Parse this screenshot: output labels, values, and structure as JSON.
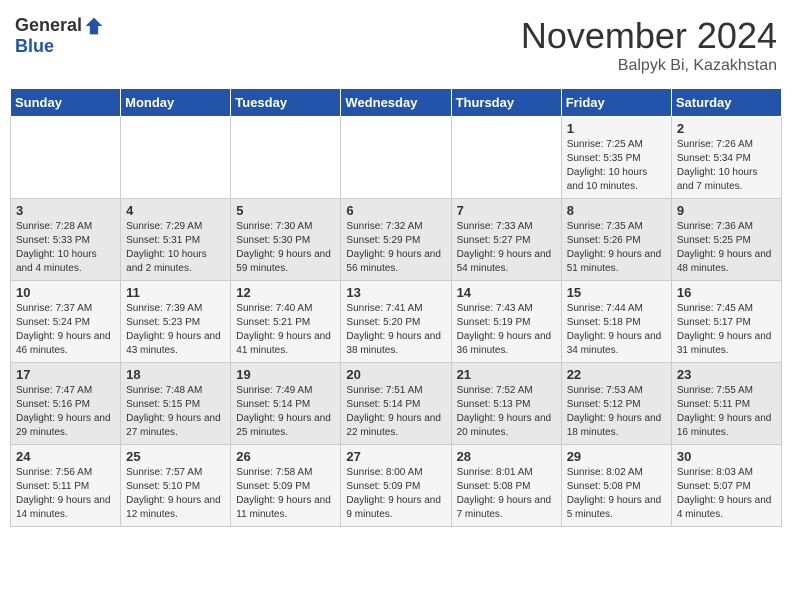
{
  "logo": {
    "general": "General",
    "blue": "Blue"
  },
  "title": {
    "month": "November 2024",
    "location": "Balpyk Bi, Kazakhstan"
  },
  "weekdays": [
    "Sunday",
    "Monday",
    "Tuesday",
    "Wednesday",
    "Thursday",
    "Friday",
    "Saturday"
  ],
  "weeks": [
    [
      {
        "day": "",
        "sunrise": "",
        "sunset": "",
        "daylight": ""
      },
      {
        "day": "",
        "sunrise": "",
        "sunset": "",
        "daylight": ""
      },
      {
        "day": "",
        "sunrise": "",
        "sunset": "",
        "daylight": ""
      },
      {
        "day": "",
        "sunrise": "",
        "sunset": "",
        "daylight": ""
      },
      {
        "day": "",
        "sunrise": "",
        "sunset": "",
        "daylight": ""
      },
      {
        "day": "1",
        "sunrise": "Sunrise: 7:25 AM",
        "sunset": "Sunset: 5:35 PM",
        "daylight": "Daylight: 10 hours and 10 minutes."
      },
      {
        "day": "2",
        "sunrise": "Sunrise: 7:26 AM",
        "sunset": "Sunset: 5:34 PM",
        "daylight": "Daylight: 10 hours and 7 minutes."
      }
    ],
    [
      {
        "day": "3",
        "sunrise": "Sunrise: 7:28 AM",
        "sunset": "Sunset: 5:33 PM",
        "daylight": "Daylight: 10 hours and 4 minutes."
      },
      {
        "day": "4",
        "sunrise": "Sunrise: 7:29 AM",
        "sunset": "Sunset: 5:31 PM",
        "daylight": "Daylight: 10 hours and 2 minutes."
      },
      {
        "day": "5",
        "sunrise": "Sunrise: 7:30 AM",
        "sunset": "Sunset: 5:30 PM",
        "daylight": "Daylight: 9 hours and 59 minutes."
      },
      {
        "day": "6",
        "sunrise": "Sunrise: 7:32 AM",
        "sunset": "Sunset: 5:29 PM",
        "daylight": "Daylight: 9 hours and 56 minutes."
      },
      {
        "day": "7",
        "sunrise": "Sunrise: 7:33 AM",
        "sunset": "Sunset: 5:27 PM",
        "daylight": "Daylight: 9 hours and 54 minutes."
      },
      {
        "day": "8",
        "sunrise": "Sunrise: 7:35 AM",
        "sunset": "Sunset: 5:26 PM",
        "daylight": "Daylight: 9 hours and 51 minutes."
      },
      {
        "day": "9",
        "sunrise": "Sunrise: 7:36 AM",
        "sunset": "Sunset: 5:25 PM",
        "daylight": "Daylight: 9 hours and 48 minutes."
      }
    ],
    [
      {
        "day": "10",
        "sunrise": "Sunrise: 7:37 AM",
        "sunset": "Sunset: 5:24 PM",
        "daylight": "Daylight: 9 hours and 46 minutes."
      },
      {
        "day": "11",
        "sunrise": "Sunrise: 7:39 AM",
        "sunset": "Sunset: 5:23 PM",
        "daylight": "Daylight: 9 hours and 43 minutes."
      },
      {
        "day": "12",
        "sunrise": "Sunrise: 7:40 AM",
        "sunset": "Sunset: 5:21 PM",
        "daylight": "Daylight: 9 hours and 41 minutes."
      },
      {
        "day": "13",
        "sunrise": "Sunrise: 7:41 AM",
        "sunset": "Sunset: 5:20 PM",
        "daylight": "Daylight: 9 hours and 38 minutes."
      },
      {
        "day": "14",
        "sunrise": "Sunrise: 7:43 AM",
        "sunset": "Sunset: 5:19 PM",
        "daylight": "Daylight: 9 hours and 36 minutes."
      },
      {
        "day": "15",
        "sunrise": "Sunrise: 7:44 AM",
        "sunset": "Sunset: 5:18 PM",
        "daylight": "Daylight: 9 hours and 34 minutes."
      },
      {
        "day": "16",
        "sunrise": "Sunrise: 7:45 AM",
        "sunset": "Sunset: 5:17 PM",
        "daylight": "Daylight: 9 hours and 31 minutes."
      }
    ],
    [
      {
        "day": "17",
        "sunrise": "Sunrise: 7:47 AM",
        "sunset": "Sunset: 5:16 PM",
        "daylight": "Daylight: 9 hours and 29 minutes."
      },
      {
        "day": "18",
        "sunrise": "Sunrise: 7:48 AM",
        "sunset": "Sunset: 5:15 PM",
        "daylight": "Daylight: 9 hours and 27 minutes."
      },
      {
        "day": "19",
        "sunrise": "Sunrise: 7:49 AM",
        "sunset": "Sunset: 5:14 PM",
        "daylight": "Daylight: 9 hours and 25 minutes."
      },
      {
        "day": "20",
        "sunrise": "Sunrise: 7:51 AM",
        "sunset": "Sunset: 5:14 PM",
        "daylight": "Daylight: 9 hours and 22 minutes."
      },
      {
        "day": "21",
        "sunrise": "Sunrise: 7:52 AM",
        "sunset": "Sunset: 5:13 PM",
        "daylight": "Daylight: 9 hours and 20 minutes."
      },
      {
        "day": "22",
        "sunrise": "Sunrise: 7:53 AM",
        "sunset": "Sunset: 5:12 PM",
        "daylight": "Daylight: 9 hours and 18 minutes."
      },
      {
        "day": "23",
        "sunrise": "Sunrise: 7:55 AM",
        "sunset": "Sunset: 5:11 PM",
        "daylight": "Daylight: 9 hours and 16 minutes."
      }
    ],
    [
      {
        "day": "24",
        "sunrise": "Sunrise: 7:56 AM",
        "sunset": "Sunset: 5:11 PM",
        "daylight": "Daylight: 9 hours and 14 minutes."
      },
      {
        "day": "25",
        "sunrise": "Sunrise: 7:57 AM",
        "sunset": "Sunset: 5:10 PM",
        "daylight": "Daylight: 9 hours and 12 minutes."
      },
      {
        "day": "26",
        "sunrise": "Sunrise: 7:58 AM",
        "sunset": "Sunset: 5:09 PM",
        "daylight": "Daylight: 9 hours and 11 minutes."
      },
      {
        "day": "27",
        "sunrise": "Sunrise: 8:00 AM",
        "sunset": "Sunset: 5:09 PM",
        "daylight": "Daylight: 9 hours and 9 minutes."
      },
      {
        "day": "28",
        "sunrise": "Sunrise: 8:01 AM",
        "sunset": "Sunset: 5:08 PM",
        "daylight": "Daylight: 9 hours and 7 minutes."
      },
      {
        "day": "29",
        "sunrise": "Sunrise: 8:02 AM",
        "sunset": "Sunset: 5:08 PM",
        "daylight": "Daylight: 9 hours and 5 minutes."
      },
      {
        "day": "30",
        "sunrise": "Sunrise: 8:03 AM",
        "sunset": "Sunset: 5:07 PM",
        "daylight": "Daylight: 9 hours and 4 minutes."
      }
    ]
  ]
}
